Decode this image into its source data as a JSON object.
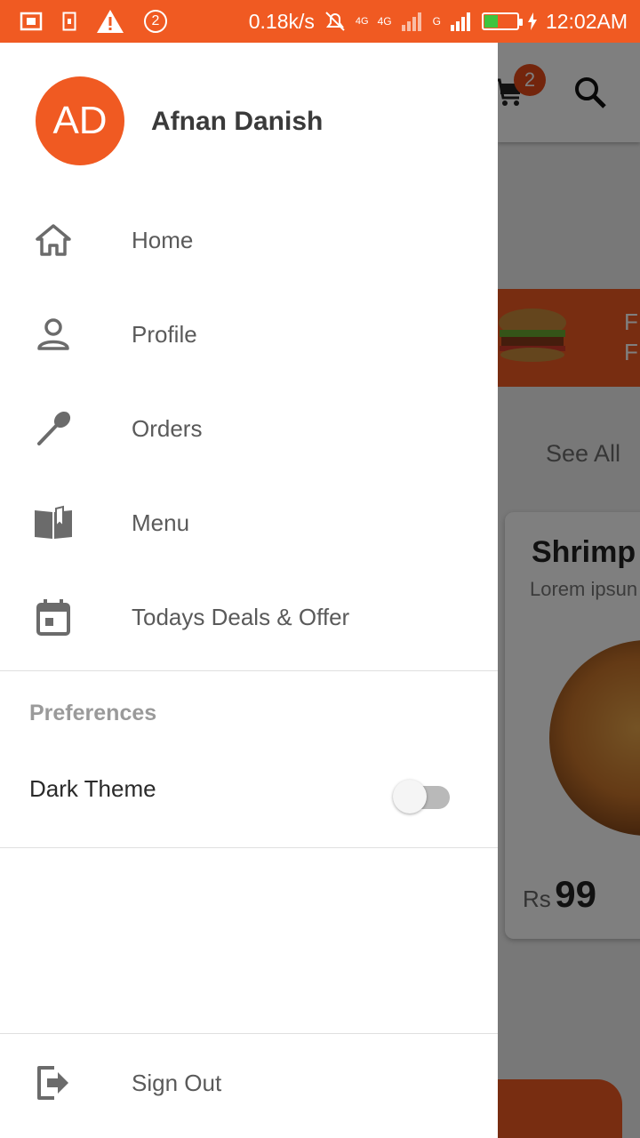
{
  "status_bar": {
    "net_speed": "0.18k/s",
    "notification_count": "2",
    "net_type_1": "4G",
    "net_type_2": "4G",
    "net_small": "G",
    "time": "12:02AM",
    "battery_level": 0.4,
    "color": "#f05a22"
  },
  "drawer": {
    "avatar_initials": "AD",
    "user_name": "Afnan Danish",
    "items": [
      {
        "label": "Home",
        "icon": "home-icon"
      },
      {
        "label": "Profile",
        "icon": "profile-icon"
      },
      {
        "label": "Orders",
        "icon": "spoon-icon"
      },
      {
        "label": "Menu",
        "icon": "book-icon"
      },
      {
        "label": "Todays Deals & Offer",
        "icon": "calendar-icon"
      }
    ],
    "preferences_title": "Preferences",
    "dark_theme_label": "Dark Theme",
    "dark_theme_on": false,
    "sign_out_label": "Sign Out"
  },
  "background": {
    "cart_count": "2",
    "promo_text_line1": "F",
    "promo_text_line2": "F",
    "see_all": "See All",
    "card_title": "Shrimp",
    "card_subtitle": "Lorem ipsun",
    "price_currency": "Rs",
    "price_value": "99"
  },
  "colors": {
    "accent": "#f05a22",
    "drawer_text": "#5a5a5a",
    "icon": "#6b6b6b"
  }
}
